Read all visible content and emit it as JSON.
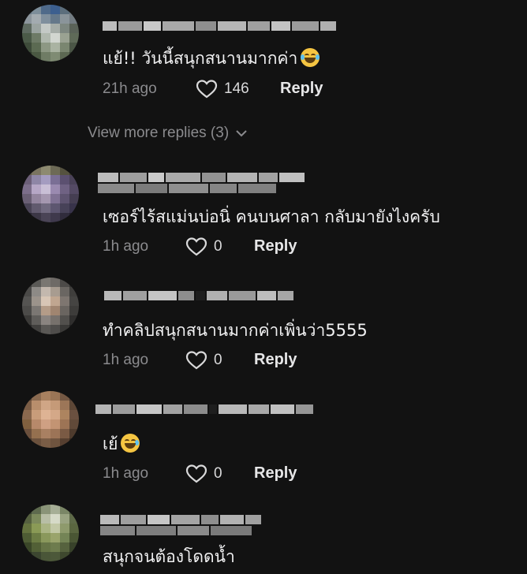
{
  "comments": [
    {
      "text": "แย้!! วันนี้สนุกสนานมากค่า",
      "time": "21h ago",
      "likes": "146",
      "reply": "Reply",
      "emoji": "grinning-sweat-face-icon"
    },
    {
      "text": "เซอร์ไร้สแม่นบ่อนิ่ คนบนศาลา กลับมายังไงครับ",
      "time": "1h ago",
      "likes": "0",
      "reply": "Reply"
    },
    {
      "text": "ทำคลิปสนุกสนานมากค่าเพิ่นว่า5555",
      "time": "1h ago",
      "likes": "0",
      "reply": "Reply"
    },
    {
      "text": "เย้",
      "time": "1h ago",
      "likes": "0",
      "reply": "Reply",
      "emoji": "grinning-sweat-face-icon"
    },
    {
      "text": "สนุกจนต้องโดดน้ำ"
    }
  ],
  "view_more": "View more replies (3)",
  "colors": {
    "background": "#121212",
    "text": "#f1f1f2",
    "muted": "#8b8b8e"
  }
}
